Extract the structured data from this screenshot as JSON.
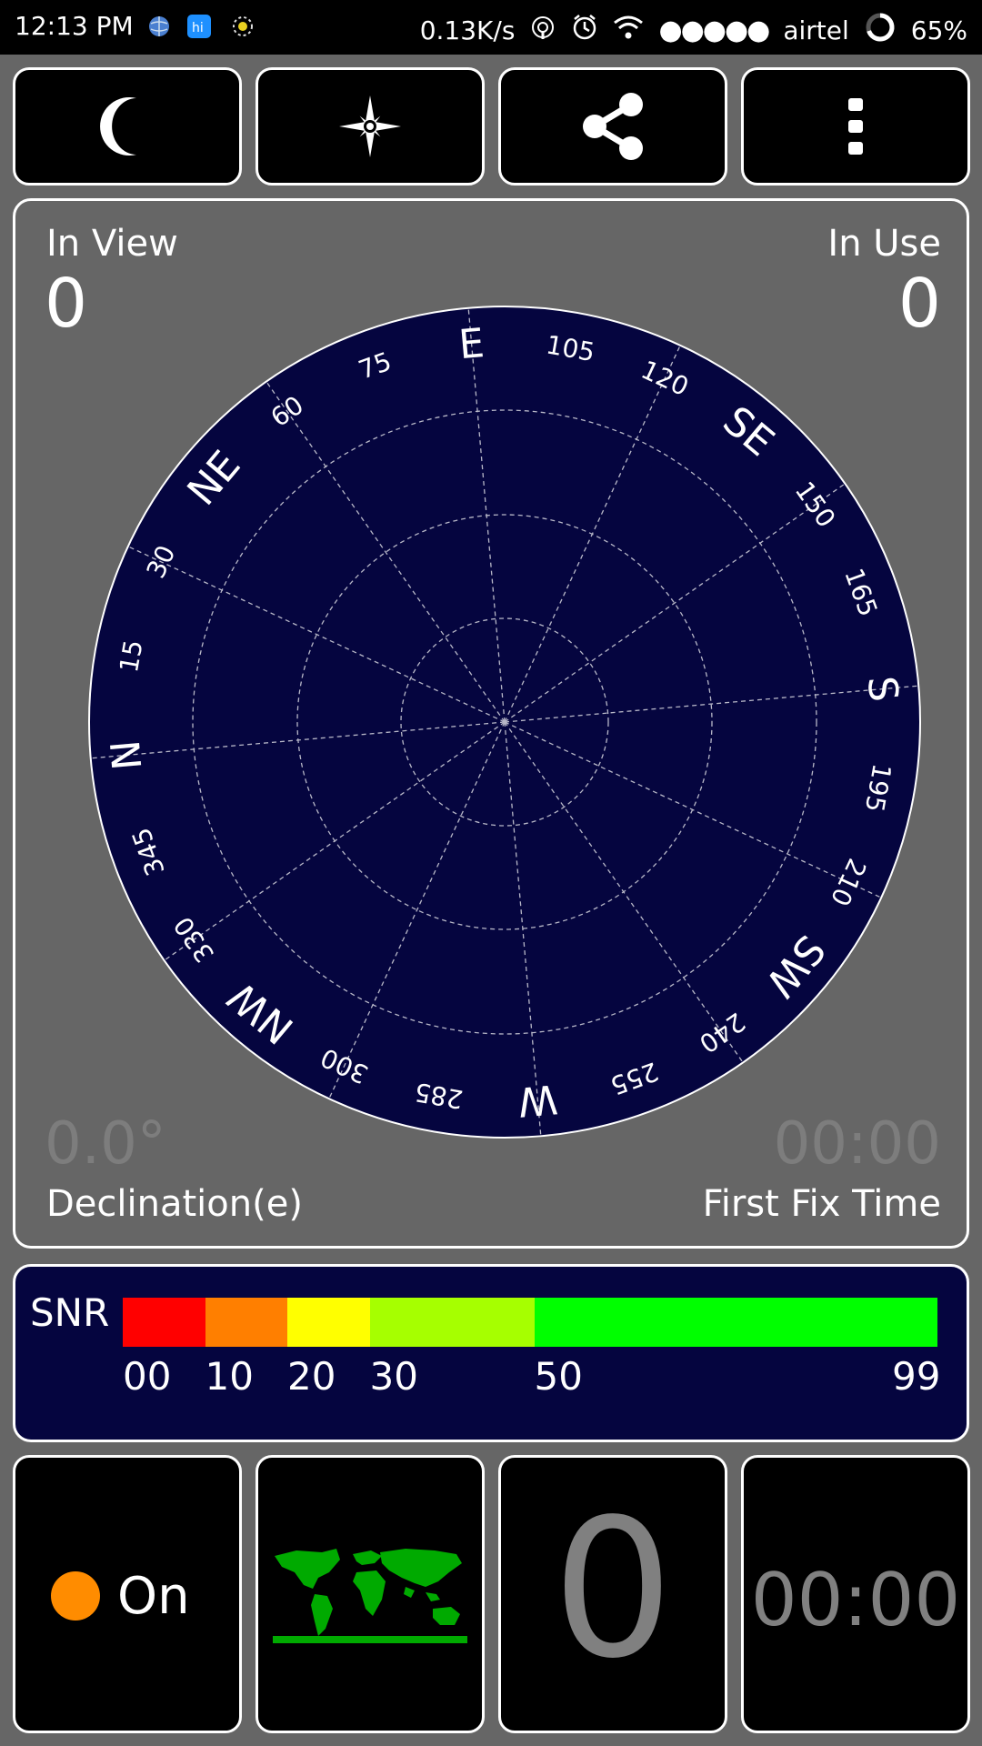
{
  "status_bar": {
    "time": "12:13 PM",
    "speed": "0.13K/s",
    "carrier": "airtel",
    "battery": "65%",
    "signal_dots": "●●●●●"
  },
  "toolbar": {
    "buttons": [
      {
        "name": "night-mode-button",
        "icon": "moon-icon"
      },
      {
        "name": "compass-button",
        "icon": "compass-star-icon"
      },
      {
        "name": "share-button",
        "icon": "share-icon"
      },
      {
        "name": "more-options-button",
        "icon": "vertical-dots-icon"
      }
    ]
  },
  "sky": {
    "in_view_label": "In View",
    "in_view_value": "0",
    "in_use_label": "In Use",
    "in_use_value": "0",
    "declination_value": "0.0°",
    "declination_label": "Declination(e)",
    "first_fix_value": "00:00",
    "first_fix_label": "First Fix Time",
    "dial_labels": [
      "N",
      "15",
      "30",
      "NE",
      "60",
      "75",
      "E",
      "105",
      "120",
      "SE",
      "150",
      "165",
      "S",
      "195",
      "210",
      "SW",
      "240",
      "255",
      "W",
      "285",
      "300",
      "NW",
      "330",
      "345"
    ],
    "dial_color": "#05053f"
  },
  "snr": {
    "title": "SNR",
    "segments": [
      {
        "from": 0,
        "to": 10,
        "color": "#ff0000"
      },
      {
        "from": 10,
        "to": 20,
        "color": "#ff7f00"
      },
      {
        "from": 20,
        "to": 30,
        "color": "#ffff00"
      },
      {
        "from": 30,
        "to": 50,
        "color": "#a6ff00"
      },
      {
        "from": 50,
        "to": 99,
        "color": "#00ff00"
      }
    ],
    "ticks": [
      "00",
      "10",
      "20",
      "30",
      "50",
      "99"
    ]
  },
  "tiles": {
    "status_label": "On",
    "status_color": "#ff8c00",
    "map_icon": "world-map-icon",
    "count_value": "0",
    "timer_value": "00:00"
  }
}
